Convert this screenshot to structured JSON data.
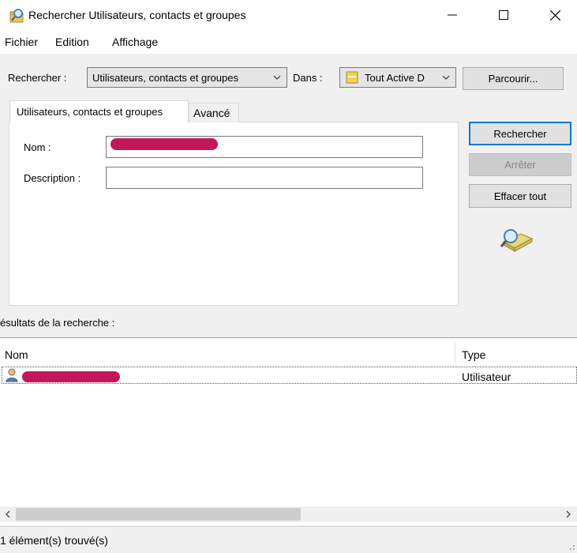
{
  "window": {
    "title": "Rechercher Utilisateurs, contacts et groupes"
  },
  "menu": {
    "items": [
      "Fichier",
      "Edition",
      "Affichage"
    ]
  },
  "search_bar": {
    "rechercher_label": "Rechercher :",
    "type_value": "Utilisateurs, contacts et groupes",
    "dans_label": "Dans :",
    "dans_value": "Tout Active D",
    "browse_label": "Parcourir..."
  },
  "tabs": {
    "main_label": "Utilisateurs, contacts et groupes",
    "advanced_label": "Avancé"
  },
  "form": {
    "nom_label": "Nom :",
    "nom_value": "",
    "description_label": "Description :",
    "description_value": ""
  },
  "actions": {
    "search_label": "Rechercher",
    "stop_label": "Arrêter",
    "clear_label": "Effacer tout"
  },
  "results": {
    "label": "ésultats de la recherche :",
    "columns": [
      "Nom",
      "Type"
    ],
    "rows": [
      {
        "name": "",
        "type": "Utilisateur"
      }
    ]
  },
  "status": {
    "text": "1 élément(s) trouvé(s)"
  },
  "colors": {
    "redaction": "#c2185b",
    "focus_border": "#0078d7"
  },
  "icons": {
    "app": "search-directory-icon",
    "folder": "directory-folder-icon",
    "user": "user-icon",
    "search_graphic": "magnifier-folder-icon"
  }
}
